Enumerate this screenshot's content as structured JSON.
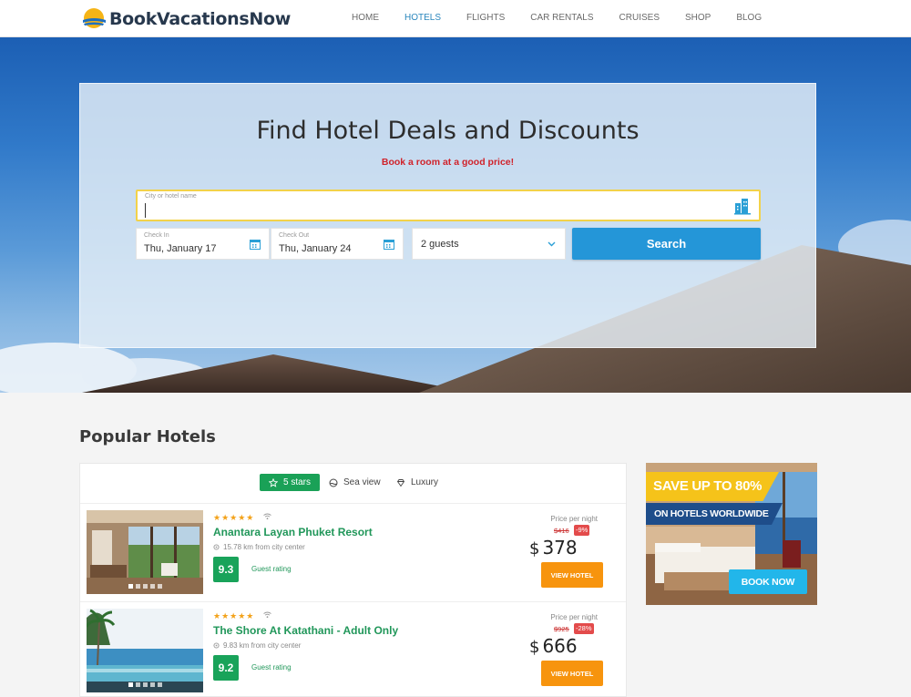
{
  "header": {
    "brand": "BookVacationsNow",
    "nav": [
      {
        "label": "HOME",
        "active": false
      },
      {
        "label": "HOTELS",
        "active": true
      },
      {
        "label": "FLIGHTS",
        "active": false
      },
      {
        "label": "CAR RENTALS",
        "active": false
      },
      {
        "label": "CRUISES",
        "active": false
      },
      {
        "label": "SHOP",
        "active": false
      },
      {
        "label": "BLOG",
        "active": false
      }
    ]
  },
  "search": {
    "title": "Find Hotel Deals and Discounts",
    "subtitle": "Book a room at a good price!",
    "city_label": "City or hotel name",
    "city_value": "",
    "check_in_label": "Check In",
    "check_in_value": "Thu, January 17",
    "check_out_label": "Check Out",
    "check_out_value": "Thu, January 24",
    "guests_value": "2 guests",
    "button_label": "Search"
  },
  "popular": {
    "title": "Popular Hotels",
    "filters": [
      {
        "label": "5 stars",
        "icon": "star-icon",
        "active": true
      },
      {
        "label": "Sea view",
        "icon": "sea-view-icon",
        "active": false
      },
      {
        "label": "Luxury",
        "icon": "diamond-icon",
        "active": false
      }
    ],
    "hotels": [
      {
        "stars": "★★★★★",
        "name": "Anantara Layan Phuket Resort",
        "distance": "15.78 km from city center",
        "rating": "9.3",
        "rating_label": "Guest rating",
        "price_label": "Price per night",
        "old_price": "$416",
        "discount": "-9%",
        "currency": "$",
        "price": "378",
        "button": "VIEW HOTEL"
      },
      {
        "stars": "★★★★★",
        "name": "The Shore At Katathani - Adult Only",
        "distance": "9.83 km from city center",
        "rating": "9.2",
        "rating_label": "Guest rating",
        "price_label": "Price per night",
        "old_price": "$925",
        "discount": "-28%",
        "currency": "$",
        "price": "666",
        "button": "VIEW HOTEL"
      }
    ]
  },
  "ad": {
    "headline": "SAVE UP TO 80%",
    "subline": "ON HOTELS WORLDWIDE",
    "button": "BOOK NOW"
  },
  "colors": {
    "accent_blue": "#2496d8",
    "green": "#1aa157",
    "orange": "#f7940e",
    "red": "#d0222a",
    "ad_yellow": "#f5c31a",
    "ad_navy": "#1e4d8a"
  }
}
